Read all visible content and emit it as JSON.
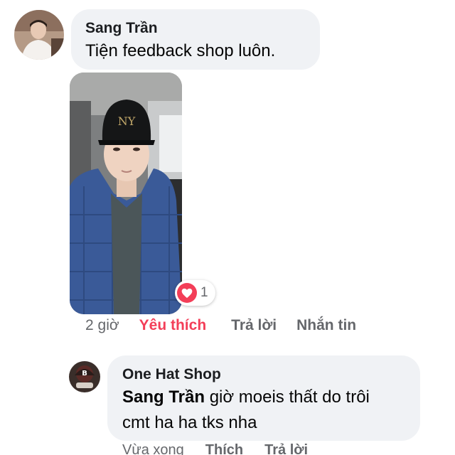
{
  "comment": {
    "author": "Sang Trần",
    "text": "Tiện feedback shop luôn.",
    "avatar_icon": "user-avatar",
    "photo_icon": "attached-selfie-photo",
    "reaction": {
      "icon": "heart-icon",
      "count": "1",
      "color": "#f33e58"
    },
    "actions": {
      "time": "2 giờ",
      "like": "Yêu thích",
      "reply": "Trả lời",
      "message": "Nhắn tin"
    }
  },
  "reply": {
    "author": "One Hat Shop",
    "mention": "Sang Trần",
    "text_line1": " giờ moeis thất do trôi",
    "text_line2": "cmt ha ha tks nha",
    "avatar_icon": "shop-avatar",
    "actions": {
      "time": "Vừa xong",
      "like": "Thích",
      "reply": "Trả lời"
    }
  },
  "colors": {
    "bubble": "#f0f2f5",
    "secondary_text": "#65676b",
    "love": "#f33e58"
  }
}
